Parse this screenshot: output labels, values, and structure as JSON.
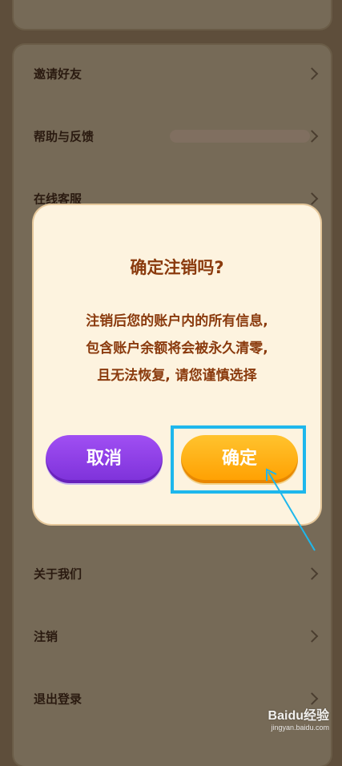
{
  "menu": {
    "items": [
      {
        "label": "邀请好友"
      },
      {
        "label": "帮助与反馈"
      },
      {
        "label": "在线客服"
      },
      {
        "label": "关于我们"
      },
      {
        "label": "注销"
      },
      {
        "label": "退出登录"
      }
    ]
  },
  "dialog": {
    "title": "确定注销吗?",
    "message_lines": [
      "注销后您的账户内的所有信息,",
      "包含账户余额将会被永久清零,",
      "且无法恢复, 请您谨慎选择"
    ],
    "cancel_label": "取消",
    "confirm_label": "确定"
  },
  "colors": {
    "dialog_text": "#8a3a0d",
    "cancel_button": "#8e3fe8",
    "confirm_button": "#ffb217",
    "highlight": "#1eb7ec"
  },
  "watermark": {
    "logo": "Baidu经验",
    "url": "jingyan.baidu.com"
  }
}
